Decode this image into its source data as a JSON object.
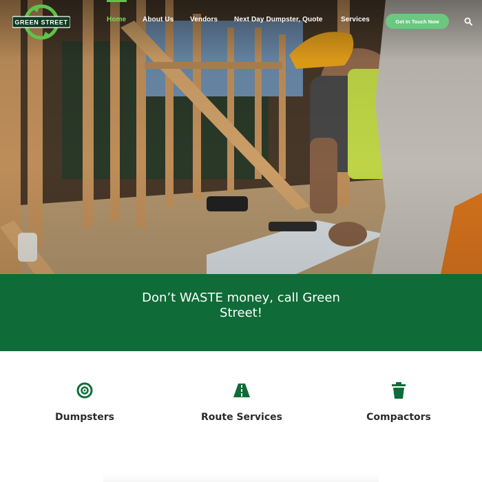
{
  "header": {
    "logo_text": "GREEN STREET",
    "nav": [
      {
        "label": "Home",
        "active": true
      },
      {
        "label": "About Us",
        "active": false
      },
      {
        "label": "Vendors",
        "active": false
      },
      {
        "label": "Next Day Dumpster, Quote",
        "active": false
      },
      {
        "label": "Services",
        "active": false
      }
    ],
    "cta_label": "Get In Touch Now",
    "search_icon": "search-icon"
  },
  "hero": {
    "image": "construction-worker-reviewing-blueprints"
  },
  "banner": {
    "text": "Don’t WASTE money, call Green Street!"
  },
  "services": [
    {
      "label": "Dumpsters",
      "icon": "target-icon"
    },
    {
      "label": "Route Services",
      "icon": "road-icon"
    },
    {
      "label": "Compactors",
      "icon": "trash-icon"
    }
  ],
  "colors": {
    "brand_green": "#0f6b37",
    "accent_green": "#5fc24a",
    "cta_green": "#6cc781",
    "active_nav": "#7ed957"
  }
}
